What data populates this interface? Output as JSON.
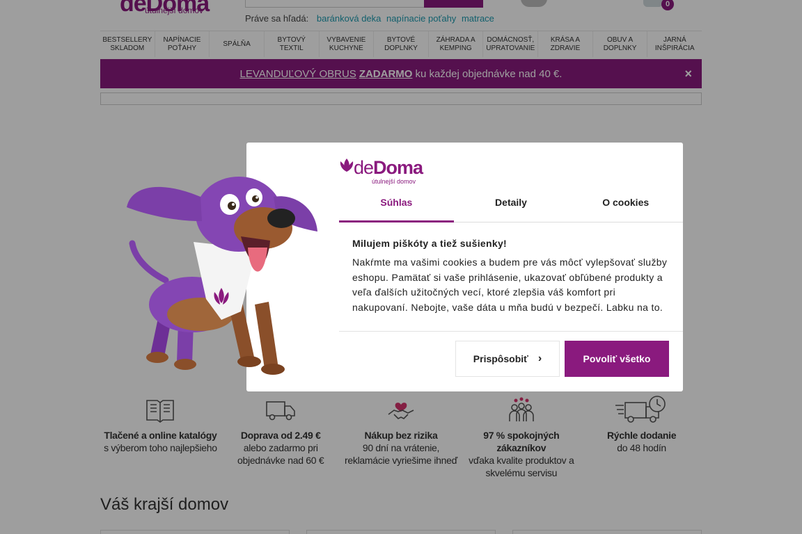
{
  "header": {
    "logo_text": "deDoma",
    "logo_tagline": "útulnejší domov",
    "trending_label": "Práve sa hľadá:",
    "trending": [
      "baránková deka",
      "napínacie poťahy",
      "matrace"
    ],
    "cart_count": "0"
  },
  "nav": {
    "items": [
      "BESTSELLERY SKLADOM",
      "NAPÍNACIE POŤAHY",
      "SPÁLŇA",
      "BYTOVÝ TEXTIL",
      "VYBAVENIE KUCHYNE",
      "BYTOVÉ DOPLNKY",
      "ZÁHRADA A KEMPING",
      "DOMÁCNOSŤ, UPRATOVANIE",
      "KRÁSA A ZDRAVIE",
      "OBUV A DOPLNKY",
      "JARNÁ INŠPIRÁCIA"
    ]
  },
  "promo": {
    "link_text": "LEVANDUĽOVÝ OBRUS",
    "bold_text": "ZADARMO",
    "rest_text": "ku každej objednávke nad 40 €.",
    "close": "×"
  },
  "features": [
    {
      "title": "Tlačené a online katalógy",
      "desc": "s výberom toho najlepšieho"
    },
    {
      "title": "Doprava od 2.49 €",
      "desc": "alebo zadarmo pri objednávke nad 60 €"
    },
    {
      "title": "Nákup bez rizika",
      "desc": "90 dní na vrátenie, reklamácie vyriešime ihneď"
    },
    {
      "title": "97 % spokojných zákazníkov",
      "desc": "vďaka kvalite produktov a skvelému servisu"
    },
    {
      "title": "Rýchle dodanie",
      "desc": "do 48 hodín"
    }
  ],
  "section_title": "Váš krajší domov",
  "cookie_dialog": {
    "logo_text_light": "de",
    "logo_text_bold": "Doma",
    "logo_tagline": "útulnejší domov",
    "tabs": [
      "Súhlas",
      "Detaily",
      "O cookies"
    ],
    "active_tab": "Súhlas",
    "heading": "Milujem piškóty a tiež sušienky!",
    "body": "Nakŕmte ma vašimi cookies a budem pre vás môcť vylepšovať služby eshopu. Pamätať si vaše prihlásenie, ukazovať obľúbené produkty a veľa ďalších užitočných vecí, ktoré zlepšia váš komfort pri nakupovaní. Nebojte, vaše dáta u mňa budú v bezpečí. Labku na to.",
    "customize_label": "Prispôsobiť",
    "allow_all_label": "Povoliť všetko"
  },
  "colors": {
    "brand": "#8a1a7e",
    "link": "#1e9bb0"
  },
  "icons": {
    "features": [
      "catalog-icon",
      "truck-icon",
      "handshake-heart-icon",
      "customers-hearts-icon",
      "fast-truck-clock-icon"
    ],
    "tab_chevron": "chevron-right-icon"
  }
}
